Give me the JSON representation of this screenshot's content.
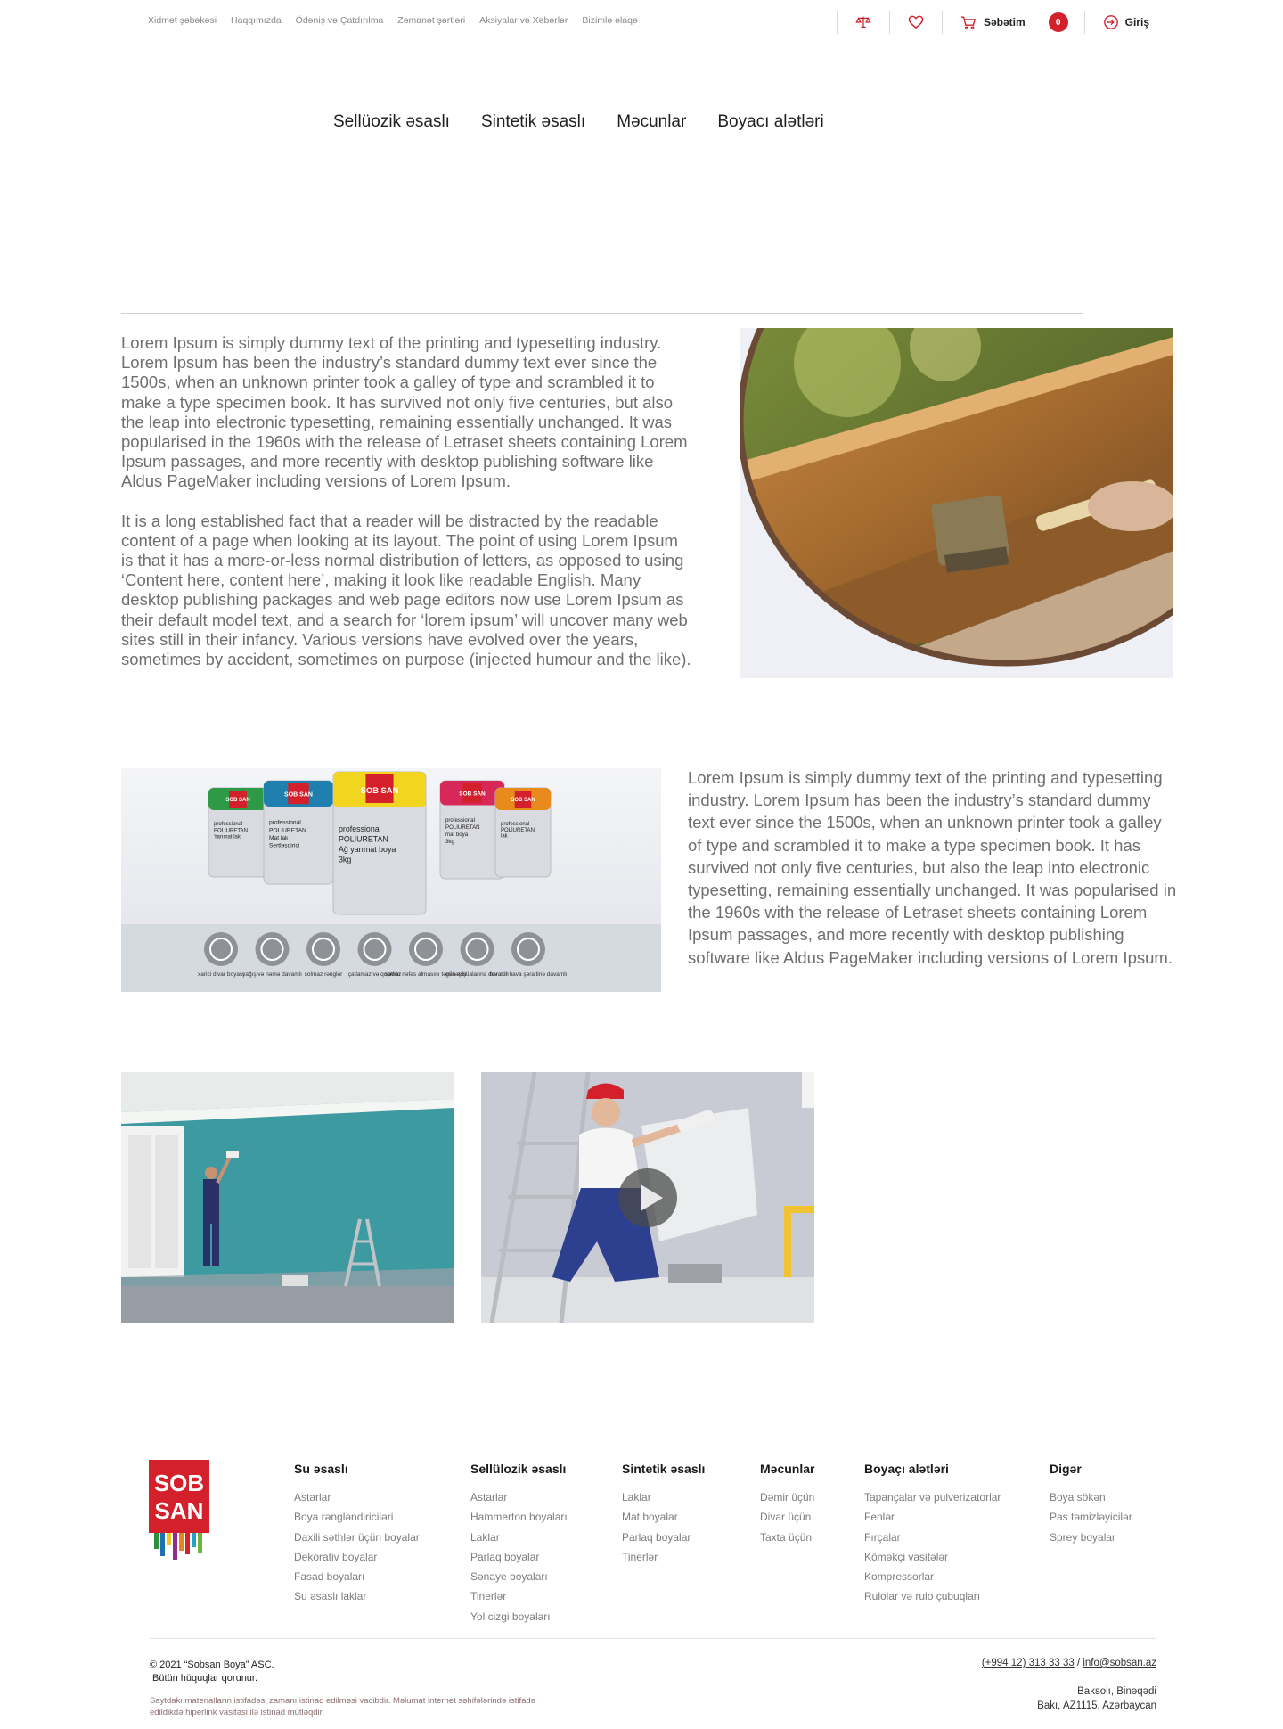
{
  "topbar": {
    "links": [
      "Xidmət şəbəkəsi",
      "Haqqımızda",
      "Ödəniş və Çatdırılma",
      "Zəmanət şərtləri",
      "Aksiyalar və Xəbərlər",
      "Bizimlə əlaqə"
    ],
    "cart_label": "Səbətim",
    "cart_count": "0",
    "login_label": "Giriş",
    "icons": [
      "compare-scale-icon",
      "heart-icon",
      "cart-icon",
      "login-icon"
    ]
  },
  "nav": {
    "items": [
      "Sellüozik əsaslı",
      "Sintetik əsaslı",
      "Məcunlar",
      "Boyacı alətləri"
    ]
  },
  "section1": {
    "paragraphs": [
      "Lorem Ipsum is simply dummy text of the printing and typesetting industry. Lorem Ipsum has been the industry’s standard dummy text ever since the 1500s, when an unknown printer took a galley of type and scrambled it to make a type specimen book. It has survived not only five centuries, but also the leap into electronic typesetting, remaining essentially unchanged. It was popularised in the 1960s with the release of Letraset sheets containing Lorem Ipsum passages, and more recently with desktop publishing software like Aldus PageMaker including versions of Lorem Ipsum.",
      "It is a long established fact that a reader will be distracted by the readable content of a page when looking at its layout. The point of using Lorem Ipsum is that it has a more-or-less normal distribution of letters, as opposed to using ‘Content here, content here’, making it look like readable English. Many desktop publishing packages and web page editors now use Lorem Ipsum as their default model text, and a search for ‘lorem ipsum’ will uncover many web sites still in their infancy. Various versions have evolved over the years, sometimes by accident, sometimes on purpose (injected humour and the like)."
    ]
  },
  "section2": {
    "paragraph": "Lorem Ipsum is simply dummy text of the printing and typesetting industry. Lorem Ipsum has been the industry’s standard dummy text ever since the 1500s, when an unknown printer took a galley of type and scrambled it to make a type specimen book. It has survived not only five centuries, but also the leap into electronic typesetting, remaining essentially unchanged. It was popularised in the 1960s with the release of Letraset sheets containing Lorem Ipsum passages, and more recently with desktop publishing software like Aldus PageMaker including versions of Lorem Ipsum.",
    "product_image": {
      "cans": [
        {
          "color": "#2e9a48",
          "brand": "SOB SAN",
          "lines": [
            "professional",
            "POLİURETAN",
            "Yarımat lak"
          ]
        },
        {
          "color": "#1f7fae",
          "brand": "SOB SAN",
          "lines": [
            "professional",
            "POLİURETAN",
            "Mat lak",
            "Sertləşdirici"
          ]
        },
        {
          "color": "#f2d51e",
          "brand": "SOB SAN",
          "lines": [
            "professional",
            "POLİURETAN",
            "Ağ yarımat boya",
            "3kg"
          ]
        },
        {
          "color": "#d8285a",
          "brand": "SOB SAN",
          "lines": [
            "professional",
            "POLİURETAN",
            "mat boya",
            "3kg"
          ]
        },
        {
          "color": "#e88a1c",
          "brand": "SOB SAN",
          "lines": [
            "professional",
            "POLİURETAN",
            "lak"
          ]
        }
      ],
      "features": [
        {
          "icon": "house-wall-icon",
          "label": "xarici divar boyası"
        },
        {
          "icon": "rain-drop-icon",
          "label": "yağış və nəmə davamlı"
        },
        {
          "icon": "color-drop-icon",
          "label": "solmaz rənglər"
        },
        {
          "icon": "crack-icon",
          "label": "çatlamaz və qopmaz"
        },
        {
          "icon": "lungs-icon",
          "label": "səthin nəfəs almasını təmin edir"
        },
        {
          "icon": "sun-icon",
          "label": "günəş şüalarına davamlı"
        },
        {
          "icon": "weather-icon",
          "label": "hər cür hava şəraitinə davamlı"
        }
      ]
    }
  },
  "videos": {
    "items": [
      {
        "name": "video-painter-room"
      },
      {
        "name": "video-painter-wall",
        "play_icon": "play-icon"
      }
    ]
  },
  "footer": {
    "logo_text": [
      "SOB",
      "SAN"
    ],
    "columns": [
      {
        "title": "Su əsaslı",
        "items": [
          "Astarlar",
          "Boya rəngləndiriciləri",
          "Daxili səthlər üçün boyalar",
          "Dekorativ boyalar",
          "Fasad boyaları",
          "Su əsaslı laklar"
        ]
      },
      {
        "title": "Sellülozik əsaslı",
        "items": [
          "Astarlar",
          "Hammerton boyaları",
          "Laklar",
          "Parlaq boyalar",
          "Sənaye boyaları",
          "Tinerlər",
          "Yol cizgi boyaları"
        ]
      },
      {
        "title": "Sintetik əsaslı",
        "items": [
          "Laklar",
          "Mat boyalar",
          "Parlaq boyalar",
          "Tinerlər"
        ]
      },
      {
        "title": "Məcunlar",
        "items": [
          "Dəmir üçün",
          "Divar üçün",
          "Taxta üçün"
        ]
      },
      {
        "title": "Boyaçı alətləri",
        "items": [
          "Tapançalar və pulverizatorlar",
          "Fenlər",
          "Fırçalar",
          "Köməkçi vasitələr",
          "Kompressorlar",
          "Rulolar və rulo çubuqları"
        ]
      },
      {
        "title": "Digər",
        "items": [
          "Boya sökən",
          "Pas təmizləyicilər",
          "Sprey boyalar"
        ]
      }
    ],
    "copyright_line1": "© 2021 “Sobsan Boya” ASC.",
    "copyright_line2": "Bütün hüquqlar qorunur.",
    "disclaimer": "Saytdakı materialların istifadəsi zamanı istinad edilməsi vacibdir. Məlumat internet səhifələrində istifadə edildikdə hiperlink vasitəsi ilə istinad mütləqdir.",
    "phone": "(+994 12) 313 33 33",
    "contact_separator": "/",
    "email": "info@sobsan.az",
    "address_line1": "Baksolı, Binəqədi",
    "address_line2": "Bakı, AZ1115, Azərbaycan"
  },
  "colors": {
    "accent_red": "#d4202a",
    "text_gray": "#6f6f6f",
    "brown_frame": "#6b4a35"
  }
}
